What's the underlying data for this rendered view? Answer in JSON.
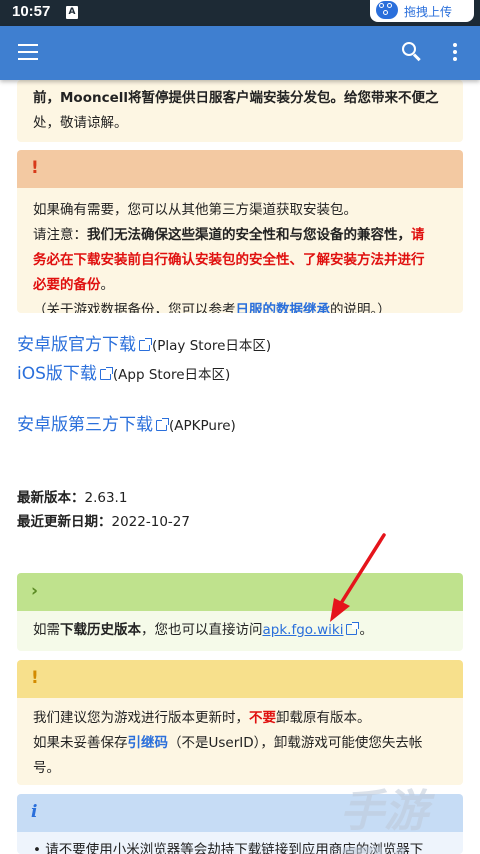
{
  "status_bar": {
    "time": "10:57",
    "notification_glyph": "A",
    "upload_label": "拖拽上传"
  },
  "app_bar": {
    "menu_icon": "hamburger-icon",
    "search_icon": "search-icon",
    "more_icon": "more-vert-icon"
  },
  "notice_partial": {
    "line1": "前，Mooncell将暂停提供日服客户端安装分发包。给您带来不便之",
    "line2": "处，敬请谅解。"
  },
  "warning_box": {
    "icon": "!",
    "line1": "如果确有需要，您可以从其他第三方渠道获取安装包。",
    "line2_prefix": "请注意：",
    "line2_bold": "我们无法确保这些渠道的安全性和与您设备的兼容性，",
    "line2_red": "请",
    "line3_red": "务必在下载安装前自行确认安装包的安全性、了解安装方法并进行",
    "line4_red": "必要的备份",
    "line4_end": "。",
    "line5_prefix": "（关于游戏数据备份，您可以参考",
    "line5_link": "日服的数据继承",
    "line5_suffix": "的说明。）"
  },
  "downloads": {
    "android_official": {
      "label": "安卓版官方下载",
      "note": "(Play Store日本区)"
    },
    "ios": {
      "label": "iOS版下载",
      "note": "(App Store日本区)"
    },
    "android_third_party": {
      "label": "安卓版第三方下载",
      "note": "(APKPure)"
    }
  },
  "version_info": {
    "latest_label": "最新版本：",
    "latest_value": "2.63.1",
    "updated_label": "最近更新日期：",
    "updated_value": "2022-10-27"
  },
  "history_box": {
    "icon": "›",
    "prefix": "如需",
    "bold": "下载历史版本",
    "middle": "，您也可以直接访问",
    "link": "apk.fgo.wiki",
    "suffix": "。"
  },
  "update_box": {
    "icon": "!",
    "line1_prefix": "我们建议您为游戏进行版本更新时，",
    "line1_red": "不要",
    "line1_suffix": "卸载原有版本。",
    "line2_prefix": "如果未妥善保存",
    "line2_link": "引继码",
    "line2_suffix": "（不是UserID），卸载游戏可能使您失去帐",
    "line3": "号。"
  },
  "info_box": {
    "icon": "i",
    "line1": "• 请不要使用小米浏览器等会劫持下载链接到应用商店的浏览器下"
  },
  "watermark": "手游TV",
  "colors": {
    "app_bar": "#3f7fd0",
    "link": "#2a6fdb",
    "warning_red": "#e0100f",
    "annotation_arrow": "#e5141b"
  }
}
